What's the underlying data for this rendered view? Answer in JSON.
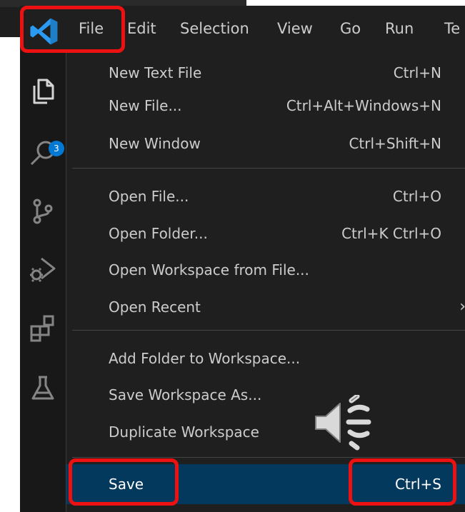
{
  "menubar": {
    "items": [
      "File",
      "Edit",
      "Selection",
      "View",
      "Go",
      "Run",
      "Te"
    ]
  },
  "activitybar": {
    "explorer_badge": "3",
    "icons": [
      "explorer-icon",
      "search-icon",
      "source-control-icon",
      "run-debug-icon",
      "extensions-icon",
      "testing-icon"
    ]
  },
  "file_menu": {
    "groups": [
      [
        {
          "label": "New Text File",
          "shortcut": "Ctrl+N"
        },
        {
          "label": "New File...",
          "shortcut": "Ctrl+Alt+Windows+N"
        },
        {
          "label": "New Window",
          "shortcut": "Ctrl+Shift+N"
        }
      ],
      [
        {
          "label": "Open File...",
          "shortcut": "Ctrl+O"
        },
        {
          "label": "Open Folder...",
          "shortcut": "Ctrl+K Ctrl+O"
        },
        {
          "label": "Open Workspace from File...",
          "shortcut": ""
        },
        {
          "label": "Open Recent",
          "shortcut": "",
          "submenu": true
        }
      ],
      [
        {
          "label": "Add Folder to Workspace...",
          "shortcut": ""
        },
        {
          "label": "Save Workspace As...",
          "shortcut": ""
        },
        {
          "label": "Duplicate Workspace",
          "shortcut": ""
        }
      ],
      [
        {
          "label": "Save",
          "shortcut": "Ctrl+S",
          "selected": true
        }
      ]
    ]
  },
  "colors": {
    "highlight": "#ee1111",
    "selection": "#04395e",
    "menu_bg": "#1f1f1f",
    "text": "#cccccc",
    "vscode_blue": "#2b9af3"
  }
}
